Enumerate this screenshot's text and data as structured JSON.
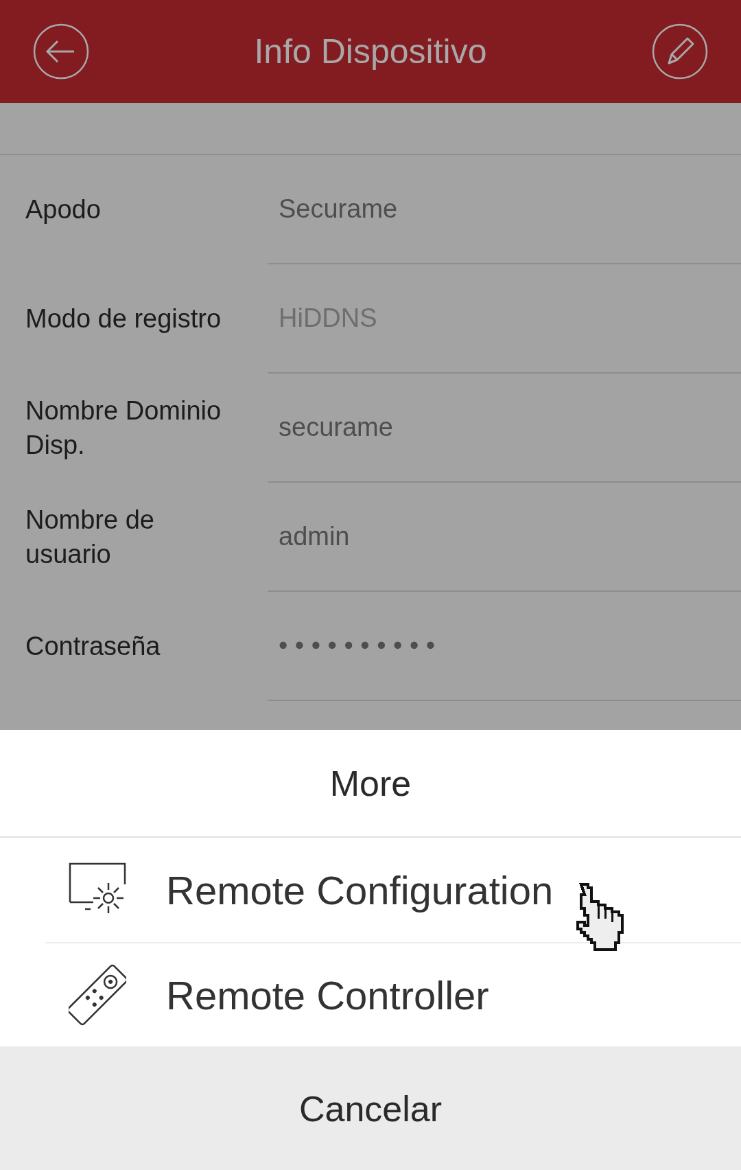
{
  "header": {
    "title": "Info Dispositivo"
  },
  "fields": [
    {
      "label": "Apodo",
      "value": "Securame",
      "disabled": false
    },
    {
      "label": "Modo de registro",
      "value": "HiDDNS",
      "disabled": true
    },
    {
      "label": "Nombre Dominio Disp.",
      "value": "securame",
      "disabled": false
    },
    {
      "label": "Nombre de usuario",
      "value": "admin",
      "disabled": false
    },
    {
      "label": "Contraseña",
      "value": "• • • • • • • • • •",
      "disabled": false
    }
  ],
  "sheet": {
    "title": "More",
    "items": [
      {
        "label": "Remote Configuration",
        "kind": "config"
      },
      {
        "label": "Remote Controller",
        "kind": "remote"
      }
    ],
    "cancel": "Cancelar"
  }
}
